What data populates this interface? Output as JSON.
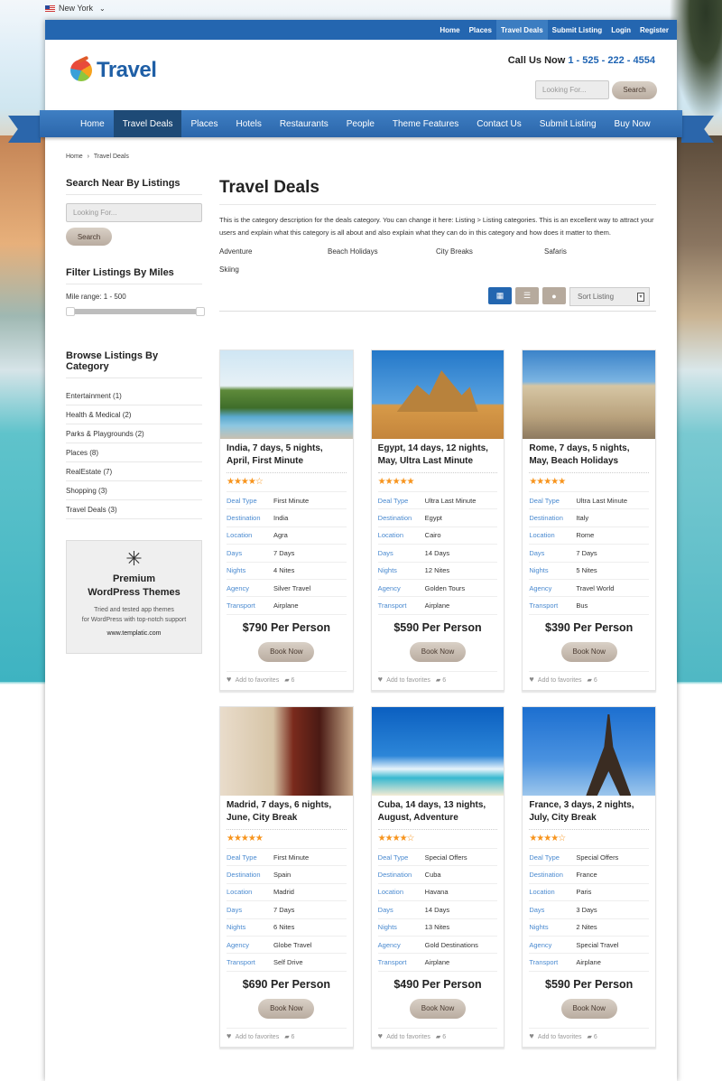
{
  "location_selector": {
    "value": "New York"
  },
  "top_nav": [
    {
      "label": "Home",
      "active": false
    },
    {
      "label": "Places",
      "active": false
    },
    {
      "label": "Travel Deals",
      "active": true
    },
    {
      "label": "Submit Listing",
      "active": false
    },
    {
      "label": "Login",
      "active": false
    },
    {
      "label": "Register",
      "active": false
    }
  ],
  "brand": {
    "name": "Travel",
    "color": "#1f5fa6"
  },
  "contact": {
    "label": "Call Us Now",
    "phone": "1 - 525 - 222 - 4554"
  },
  "header_search": {
    "placeholder": "Looking For...",
    "button": "Search"
  },
  "main_nav": [
    {
      "label": "Home"
    },
    {
      "label": "Travel Deals"
    },
    {
      "label": "Places"
    },
    {
      "label": "Hotels"
    },
    {
      "label": "Restaurants"
    },
    {
      "label": "People"
    },
    {
      "label": "Theme Features"
    },
    {
      "label": "Contact Us"
    },
    {
      "label": "Submit Listing"
    },
    {
      "label": "Buy Now"
    }
  ],
  "breadcrumb": {
    "home": "Home",
    "separator": "›",
    "current": "Travel Deals"
  },
  "sidebar": {
    "search": {
      "title": "Search Near By Listings",
      "placeholder": "Looking For...",
      "button": "Search"
    },
    "miles": {
      "title": "Filter Listings By Miles",
      "range_label": "Mile range: 1 - 500",
      "min": 1,
      "max": 500
    },
    "categories": {
      "title": "Browse Listings By Category",
      "items": [
        {
          "label": "Entertainment (1)"
        },
        {
          "label": "Health & Medical (2)"
        },
        {
          "label": "Parks & Playgrounds (2)"
        },
        {
          "label": "Places (8)"
        },
        {
          "label": "RealEstate (7)"
        },
        {
          "label": "Shopping (3)"
        },
        {
          "label": "Travel Deals (3)"
        }
      ]
    },
    "ad": {
      "title_line1": "Premium",
      "title_line2": "WordPress Themes",
      "sub_line1": "Tried and tested app themes",
      "sub_line2": "for WordPress with top-notch support",
      "url": "www.templatic.com"
    }
  },
  "main": {
    "title": "Travel Deals",
    "description": "This is the category description for the deals category. You can change it here: Listing > Listing categories. This is an excellent way to attract your users and explain what this category is all about and also explain what they can do in this category and how does it matter to them.",
    "subcategories": [
      "Adventure",
      "Beach Holidays",
      "City Breaks",
      "Safaris",
      "Skiing"
    ],
    "view_buttons": [
      {
        "icon": "grid-icon",
        "active": true
      },
      {
        "icon": "list-icon",
        "active": false
      },
      {
        "icon": "map-pin-icon",
        "active": false
      }
    ],
    "sort": {
      "value": "Sort Listing"
    },
    "field_labels": {
      "deal_type": "Deal Type",
      "destination": "Destination",
      "location": "Location",
      "days": "Days",
      "nights": "Nights",
      "agency": "Agency",
      "transport": "Transport"
    },
    "book_label": "Book Now",
    "favorites_label": "Add to favorites",
    "listings": [
      {
        "title": "India, 7 days, 5 nights, April, First Minute",
        "rating": 4,
        "stars": "★★★★☆",
        "deal_type": "First Minute",
        "destination": "India",
        "location": "Agra",
        "days": "7 Days",
        "nights": "4 Nites",
        "agency": "Silver Travel",
        "transport": "Airplane",
        "price": "$790 Per Person",
        "comments": "6",
        "image": "india"
      },
      {
        "title": "Egypt, 14 days, 12 nights, May, Ultra Last Minute",
        "rating": 5,
        "stars": "★★★★★",
        "deal_type": "Ultra Last Minute",
        "destination": "Egypt",
        "location": "Cairo",
        "days": "14 Days",
        "nights": "12 Nites",
        "agency": "Golden Tours",
        "transport": "Airplane",
        "price": "$590 Per Person",
        "comments": "6",
        "image": "egypt"
      },
      {
        "title": "Rome, 7 days, 5 nights, May, Beach Holidays",
        "rating": 5,
        "stars": "★★★★★",
        "deal_type": "Ultra Last Minute",
        "destination": "Italy",
        "location": "Rome",
        "days": "7 Days",
        "nights": "5 Nites",
        "agency": "Travel World",
        "transport": "Bus",
        "price": "$390 Per Person",
        "comments": "6",
        "image": "rome"
      },
      {
        "title": "Madrid, 7 days, 6 nights, June, City Break",
        "rating": 5,
        "stars": "★★★★★",
        "deal_type": "First Minute",
        "destination": "Spain",
        "location": "Madrid",
        "days": "7 Days",
        "nights": "6 Nites",
        "agency": "Globe Travel",
        "transport": "Self Drive",
        "price": "$690 Per Person",
        "comments": "6",
        "image": "madrid"
      },
      {
        "title": "Cuba, 14 days, 13 nights, August, Adventure",
        "rating": 4,
        "stars": "★★★★☆",
        "deal_type": "Special Offers",
        "destination": "Cuba",
        "location": "Havana",
        "days": "14 Days",
        "nights": "13 Nites",
        "agency": "Gold Destinations",
        "transport": "Airplane",
        "price": "$490 Per Person",
        "comments": "6",
        "image": "cuba"
      },
      {
        "title": "France, 3 days, 2 nights, July, City Break",
        "rating": 4,
        "stars": "★★★★☆",
        "deal_type": "Special Offers",
        "destination": "France",
        "location": "Paris",
        "days": "3 Days",
        "nights": "2 Nites",
        "agency": "Special Travel",
        "transport": "Airplane",
        "price": "$590 Per Person",
        "comments": "6",
        "image": "france"
      }
    ]
  }
}
